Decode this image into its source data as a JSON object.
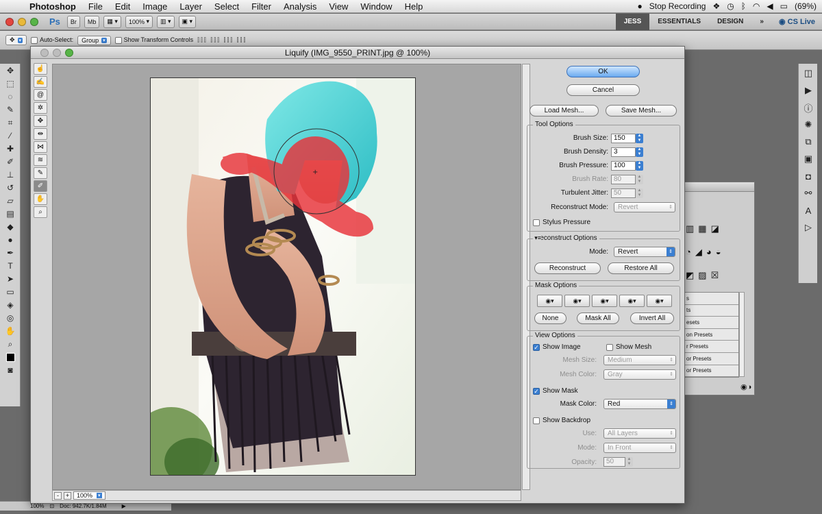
{
  "menubar": {
    "app": "Photoshop",
    "items": [
      "File",
      "Edit",
      "Image",
      "Layer",
      "Select",
      "Filter",
      "Analysis",
      "View",
      "Window",
      "Help"
    ],
    "stop_recording": "Stop Recording",
    "battery": "(69%)"
  },
  "appbar": {
    "ps_logo": "Ps",
    "br": "Br",
    "mb": "Mb",
    "zoom": "100%",
    "workspaces": [
      "JESS",
      "ESSENTIALS",
      "DESIGN"
    ],
    "more": "»",
    "cs_live": "CS Live"
  },
  "optbar": {
    "auto_select": "Auto-Select:",
    "group": "Group",
    "show_transform": "Show Transform Controls"
  },
  "dialog": {
    "title": "Liquify (IMG_9550_PRINT.jpg @ 100%)",
    "ok": "OK",
    "cancel": "Cancel",
    "load_mesh": "Load Mesh...",
    "save_mesh": "Save Mesh...",
    "zoom": "100%",
    "tool_options": {
      "title": "Tool Options",
      "brush_size_label": "Brush Size:",
      "brush_size": "150",
      "brush_density_label": "Brush Density:",
      "brush_density": "3",
      "brush_pressure_label": "Brush Pressure:",
      "brush_pressure": "100",
      "brush_rate_label": "Brush Rate:",
      "brush_rate": "80",
      "turbulent_jitter_label": "Turbulent Jitter:",
      "turbulent_jitter": "50",
      "reconstruct_mode_label": "Reconstruct Mode:",
      "reconstruct_mode": "Revert",
      "stylus_pressure": "Stylus Pressure"
    },
    "reconstruct_options": {
      "title": "Reconstruct Options",
      "mode_label": "Mode:",
      "mode": "Revert",
      "reconstruct": "Reconstruct",
      "restore_all": "Restore All"
    },
    "mask_options": {
      "title": "Mask Options",
      "none": "None",
      "mask_all": "Mask All",
      "invert_all": "Invert All"
    },
    "view_options": {
      "title": "View Options",
      "show_image": "Show Image",
      "show_mesh": "Show Mesh",
      "mesh_size_label": "Mesh Size:",
      "mesh_size": "Medium",
      "mesh_color_label": "Mesh Color:",
      "mesh_color": "Gray",
      "show_mask": "Show Mask",
      "mask_color_label": "Mask Color:",
      "mask_color": "Red",
      "show_backdrop": "Show Backdrop",
      "use_label": "Use:",
      "use": "All Layers",
      "mode_label": "Mode:",
      "mode": "In Front",
      "opacity_label": "Opacity:",
      "opacity": "50"
    }
  },
  "bgpanel": {
    "presets": [
      "s",
      "ts",
      "esets",
      "on Presets",
      "r Presets",
      "or Presets",
      "or Presets"
    ]
  },
  "statusbar": {
    "zoom": "100%",
    "doc": "Doc: 942.7K/1.84M"
  },
  "colors": {
    "mask_red": "#e8333a",
    "accent_blue": "#3b7fd1",
    "hair_cyan": "#44d3d6"
  }
}
